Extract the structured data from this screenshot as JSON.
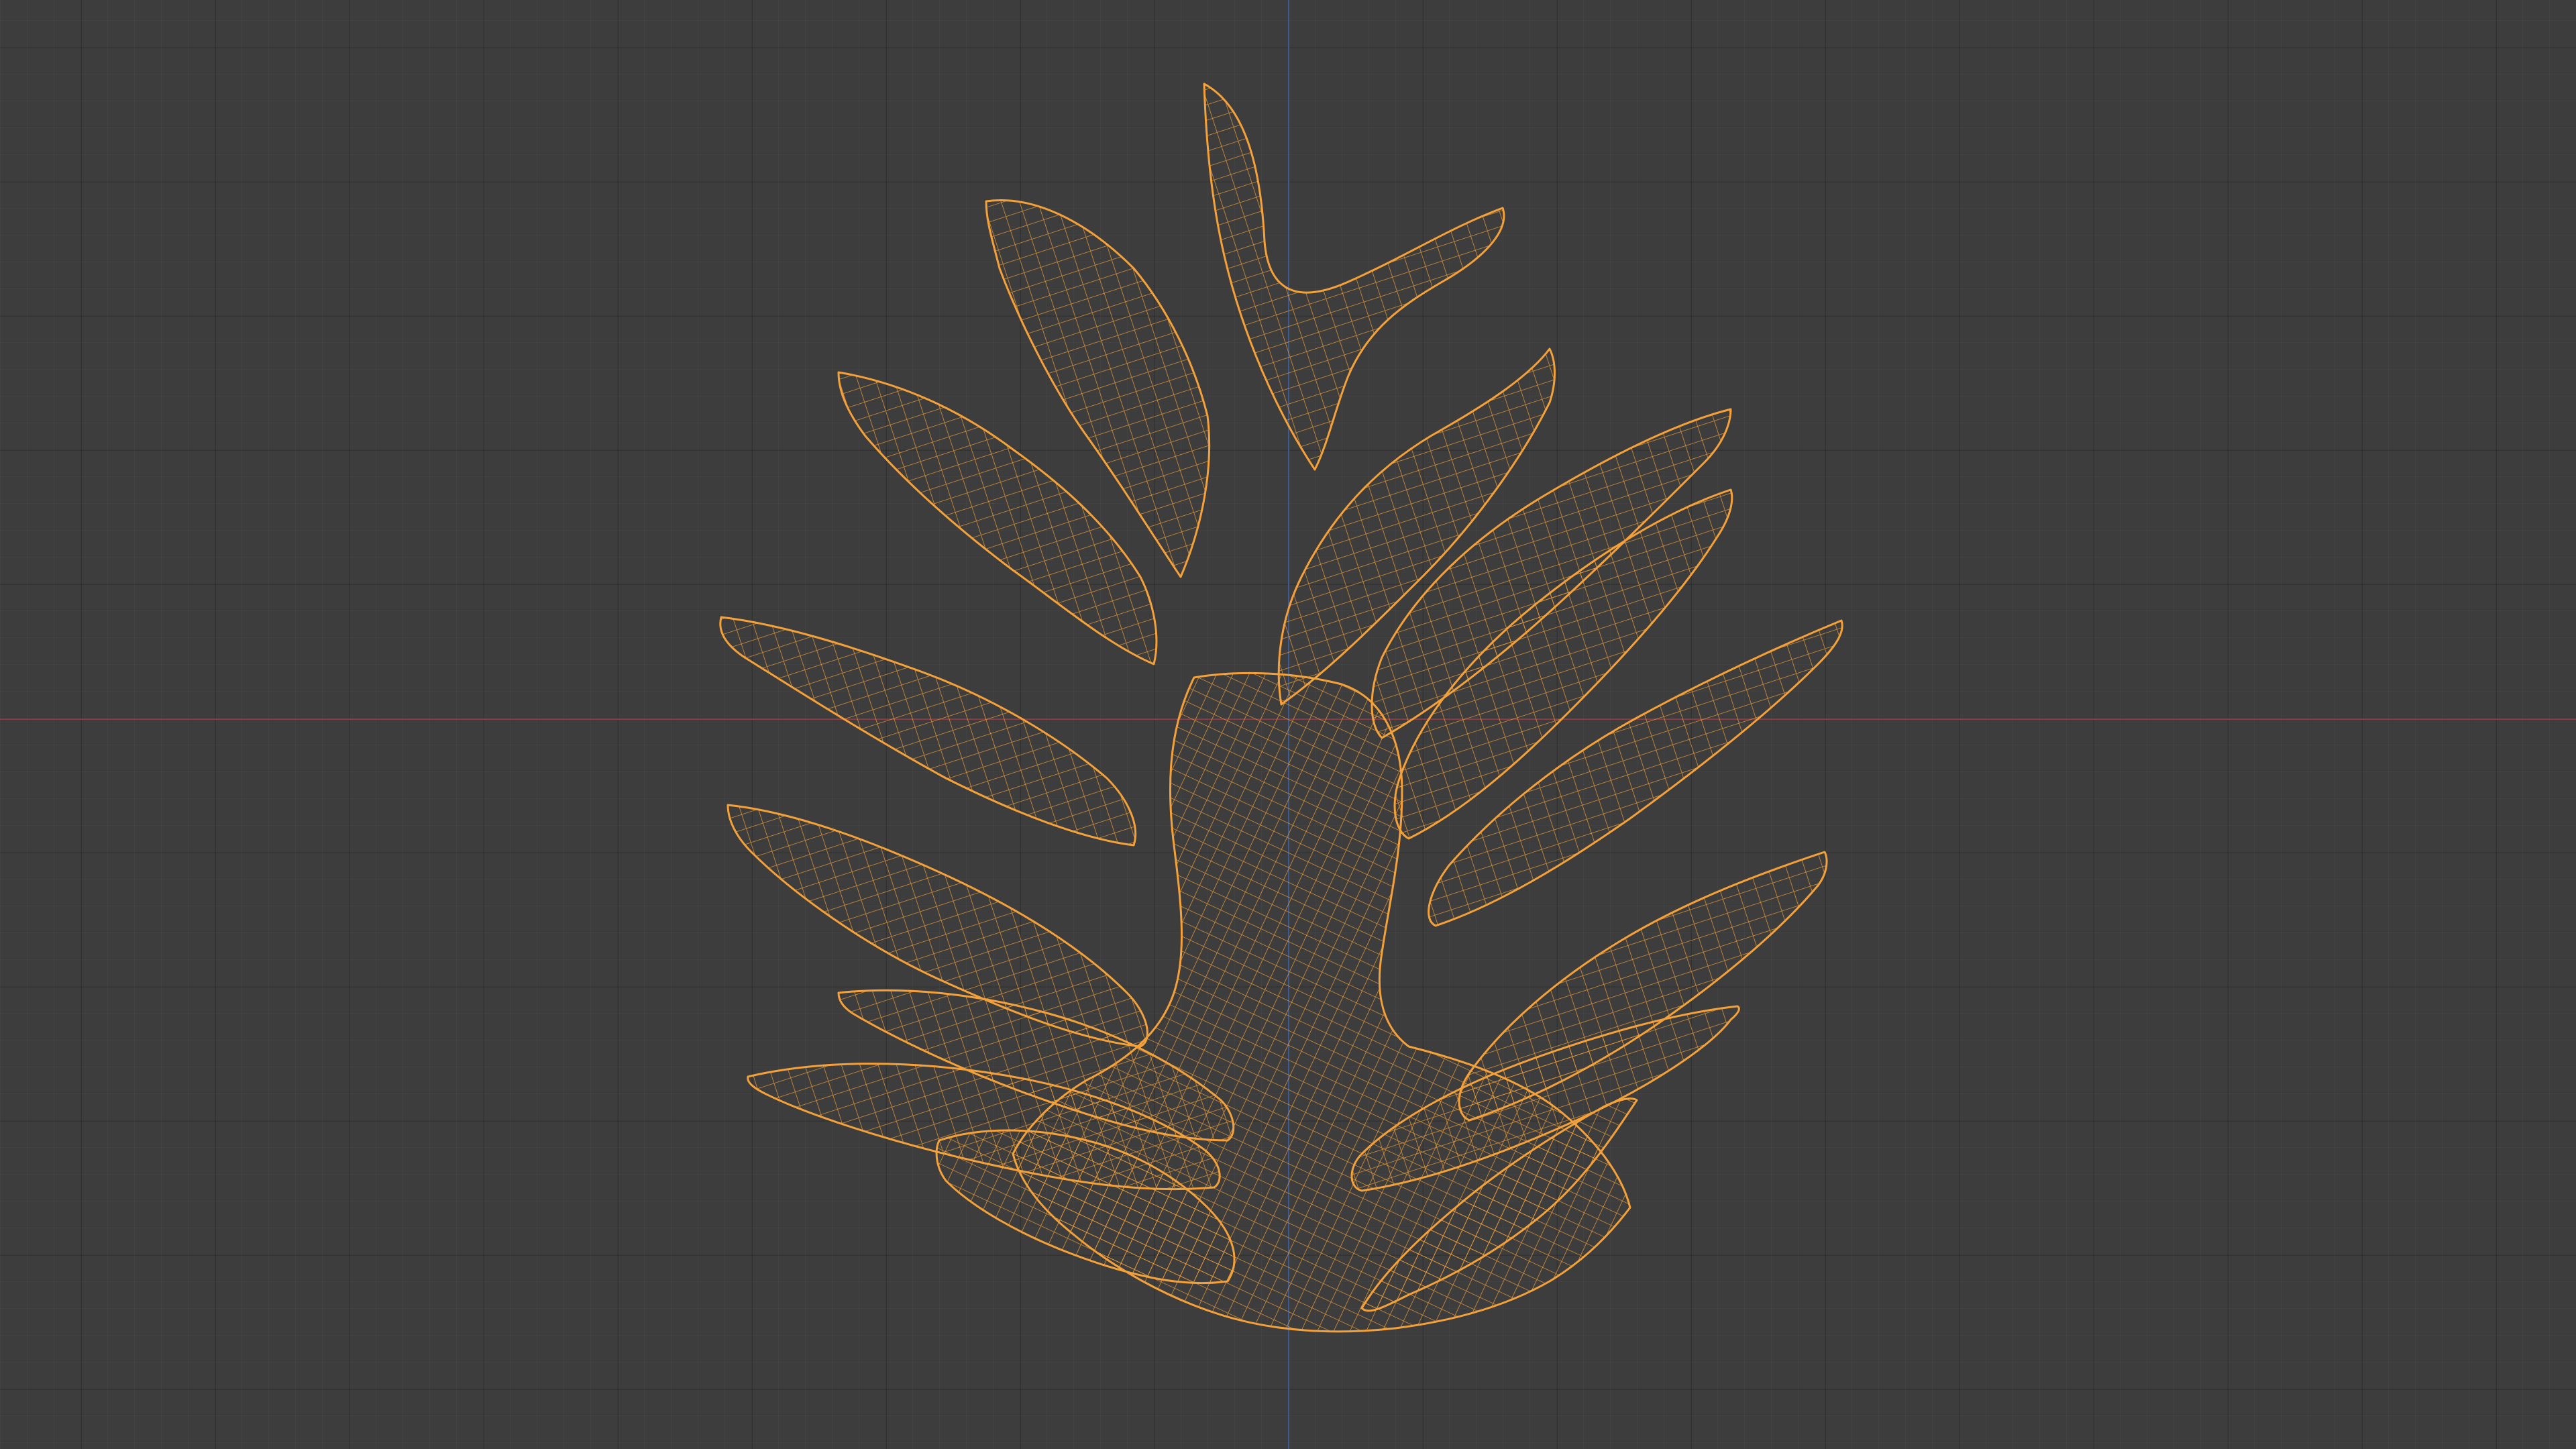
{
  "viewport": {
    "background_color": "#3d3d3d",
    "grid_color": "#464646",
    "x_axis_color": "#8a3d46",
    "y_axis_color": "#3e5a92"
  },
  "object": {
    "type": "pinecone-mesh",
    "display": "wireframe",
    "selected": true,
    "wire_color": "#f5a13a"
  }
}
